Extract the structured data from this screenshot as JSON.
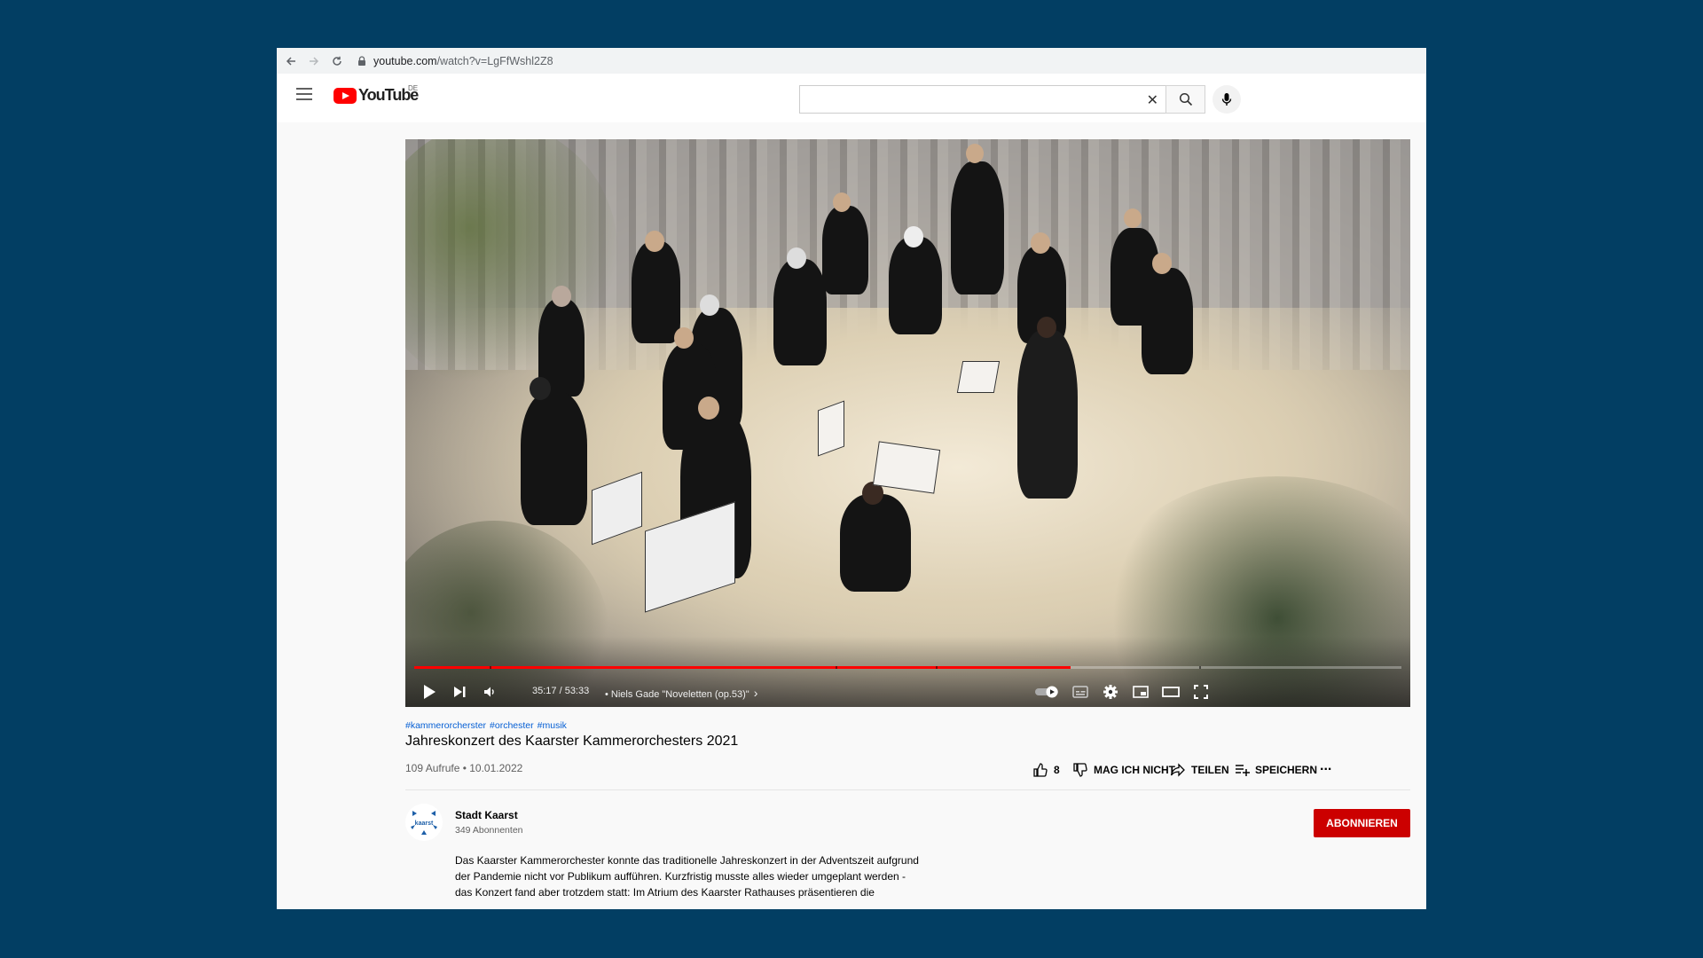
{
  "browser": {
    "url_host": "youtube.com",
    "url_path": "/watch?v=LgFfWshl2Z8"
  },
  "header": {
    "logo_text": "YouTube",
    "country_code": "DE",
    "search_value": ""
  },
  "player": {
    "progress_fraction": 0.665,
    "time": "35:17 / 53:33",
    "chapter": "•  Niels Gade \"Noveletten (op.53)\"",
    "chapter_arrow": "›"
  },
  "video": {
    "tags": [
      "#kammerorcherster",
      "#orchester",
      "#musik"
    ],
    "title": "Jahreskonzert des Kaarster Kammerorchesters 2021",
    "views_date": "109 Aufrufe • 10.01.2022"
  },
  "actions": {
    "like_count": "8",
    "dislike_label": "MAG ICH NICHT",
    "share_label": "TEILEN",
    "save_label": "SPEICHERN",
    "more_label": "..."
  },
  "channel": {
    "name": "Stadt Kaarst",
    "subscribers": "349 Abonnenten",
    "avatar_text": "kaarst",
    "subscribe_label": "ABONNIEREN"
  },
  "description": {
    "lines": [
      "Das Kaarster Kammerorchester konnte das traditionelle Jahreskonzert in der Adventszeit aufgrund",
      "der Pandemie nicht vor Publikum aufführen. Kurzfristig musste alles wieder umgeplant werden -",
      "das Konzert fand aber trotzdem statt: Im Atrium des Kaarster Rathauses präsentieren die"
    ]
  },
  "colors": {
    "background": "#023e63",
    "brand_red": "#ff0000",
    "subscribe_red": "#cc0000",
    "link_blue": "#065fd4"
  }
}
